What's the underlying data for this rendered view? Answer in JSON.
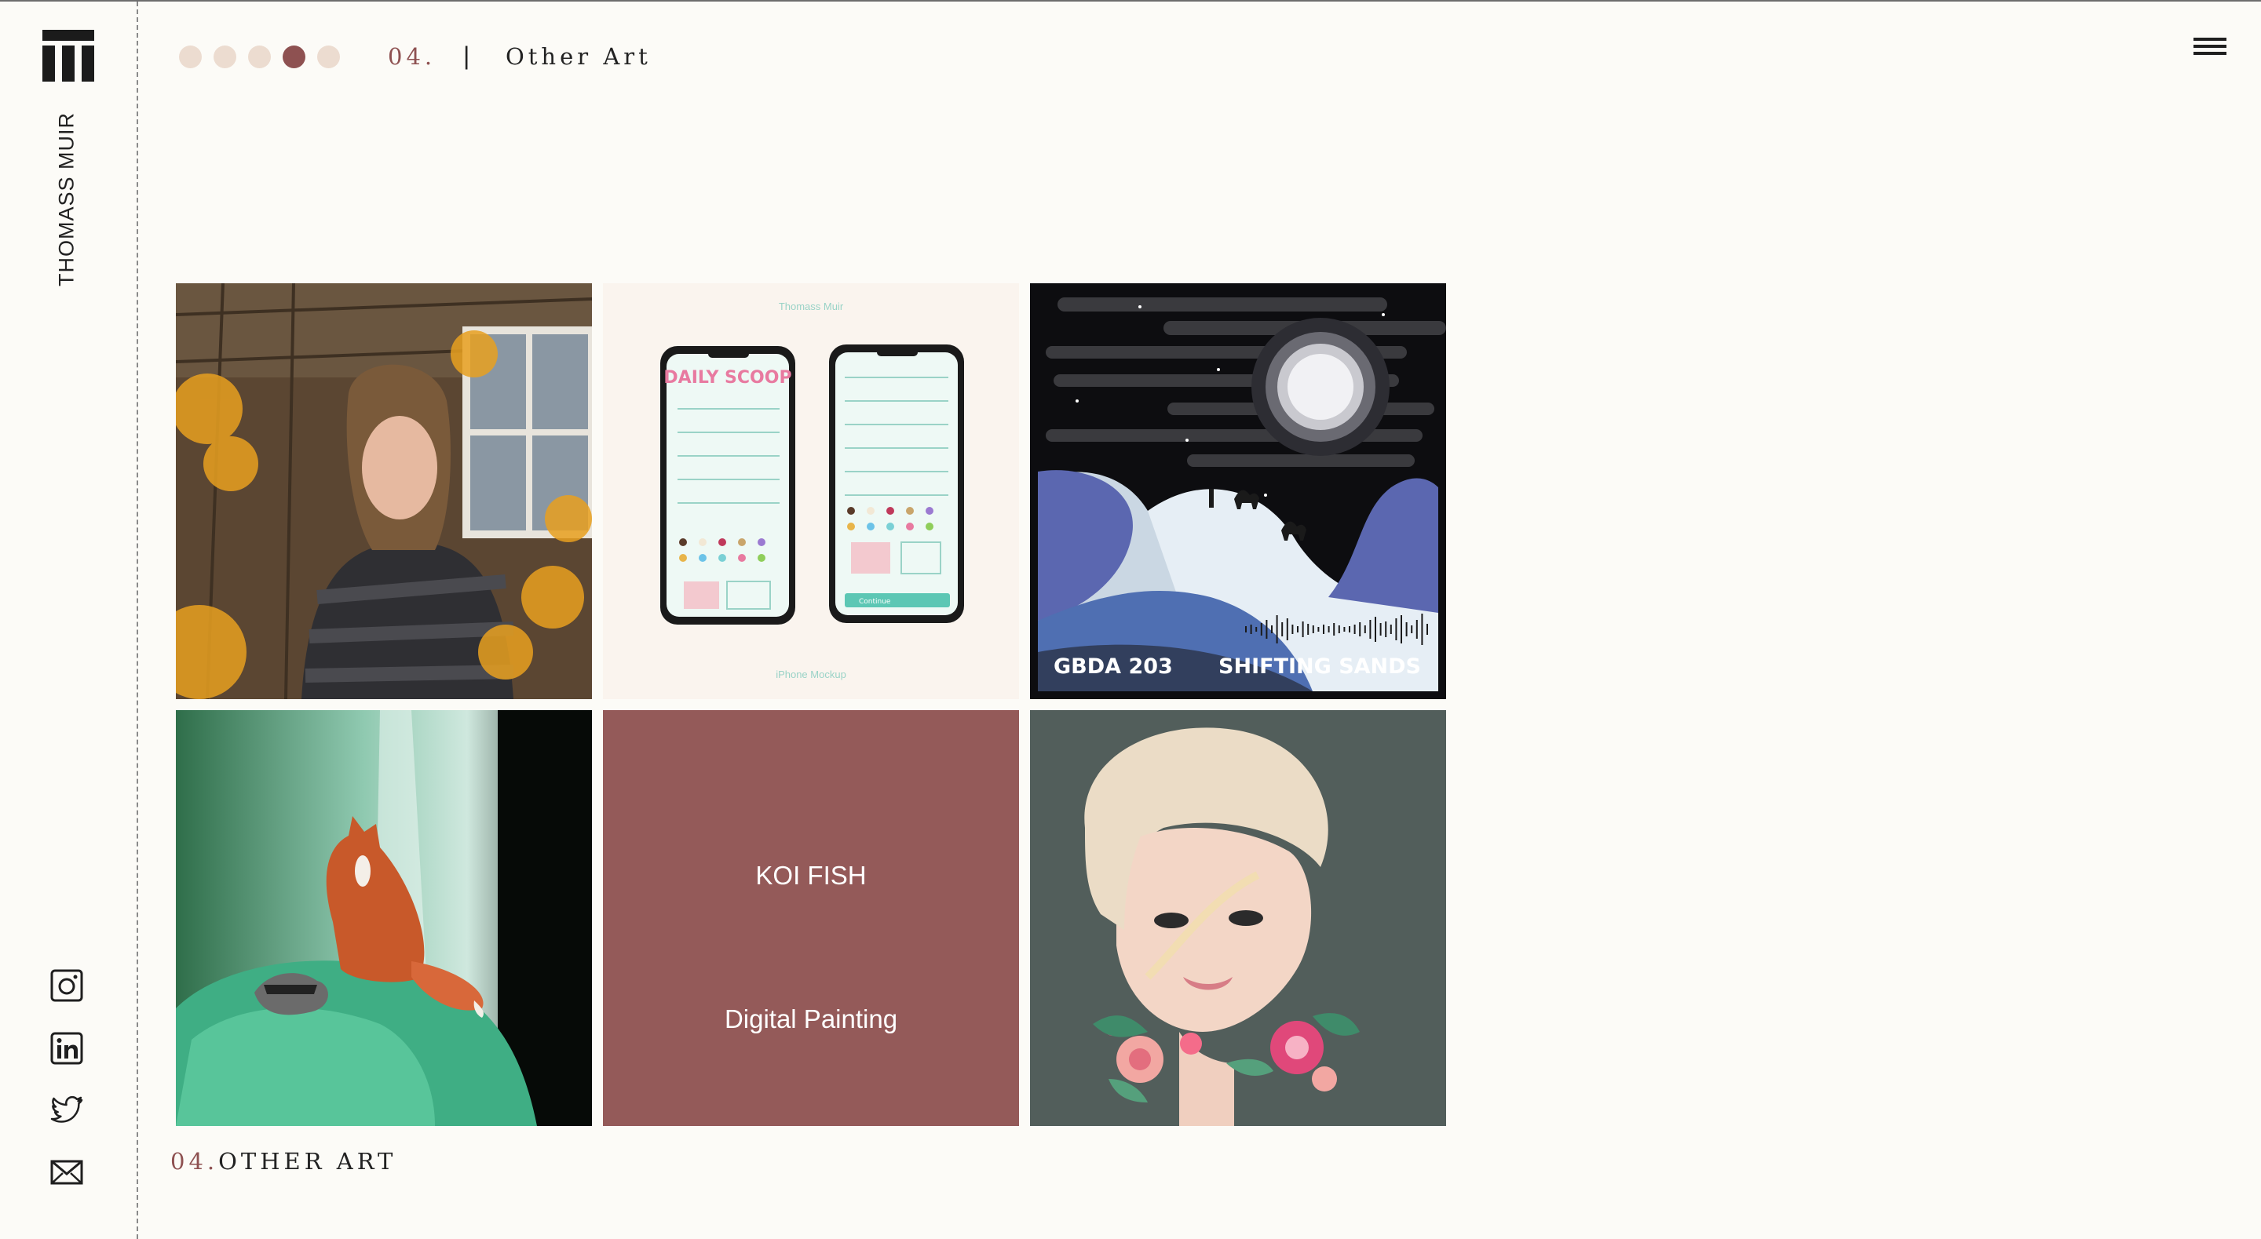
{
  "brand": {
    "author": "THOMASS MUIR"
  },
  "header": {
    "section_number": "04.",
    "separator": "|",
    "section_title": "Other Art",
    "progress": {
      "total": 5,
      "active": 4
    },
    "menu_icon": "hamburger-menu-icon"
  },
  "social": [
    "instagram-icon",
    "linkedin-icon",
    "twitter-icon",
    "mail-icon"
  ],
  "gallery": {
    "tile2": {
      "top_caption": "Thomass Muir",
      "bottom_caption": "iPhone Mockup",
      "app_logo": "DAILY SCOOP",
      "button": "Continue"
    },
    "tile3": {
      "left_label": "GBDA 203",
      "right_label": "SHIFTING SANDS"
    },
    "tile5": {
      "title": "KOI FISH",
      "subtitle": "Digital Painting"
    }
  },
  "footer": {
    "number": "04.",
    "label": "OTHER ART"
  },
  "colors": {
    "accent": "#8e5151",
    "dot_inactive": "#ecdcd0",
    "background": "#fcfbf7",
    "koi_tile": "#945a59"
  }
}
